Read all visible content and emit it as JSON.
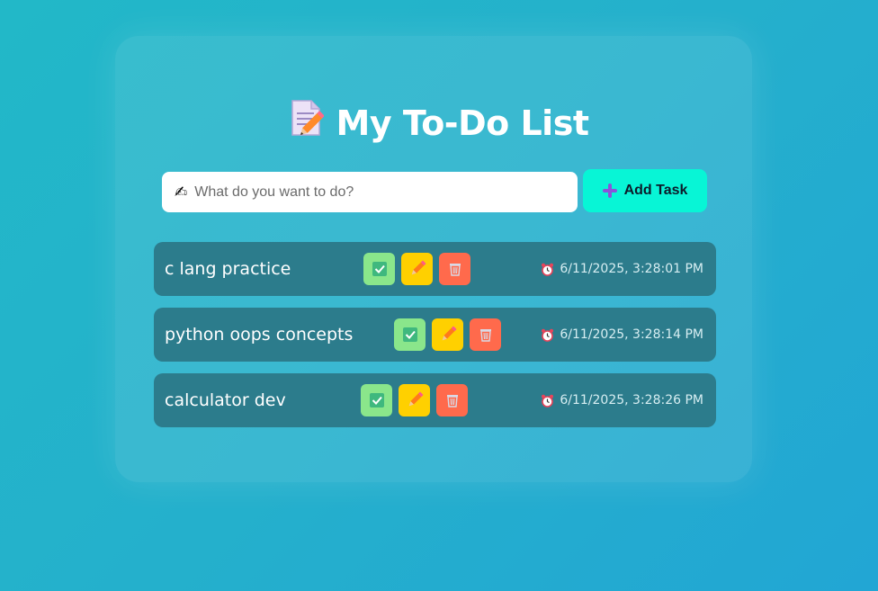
{
  "header": {
    "title": "My To-Do List",
    "title_icon": "memo-pencil-icon"
  },
  "input": {
    "placeholder": "What do you want to do?",
    "value": "",
    "icon": "writing-hand-icon"
  },
  "add_button": {
    "label": "Add Task",
    "icon": "plus-icon"
  },
  "tasks": [
    {
      "name": "c lang practice",
      "timestamp": "6/11/2025, 3:28:01 PM"
    },
    {
      "name": "python oops concepts",
      "timestamp": "6/11/2025, 3:28:14 PM"
    },
    {
      "name": "calculator dev",
      "timestamp": "6/11/2025, 3:28:26 PM"
    }
  ],
  "task_actions": [
    "check-icon",
    "pencil-icon",
    "trash-icon"
  ],
  "colors": {
    "background": "#22b0cc",
    "task_row": "#2c7c8c",
    "add_button": "#08f5d6",
    "done_button": "#8ae68b",
    "edit_button": "#ffd000",
    "delete_button": "#ff6a4c"
  }
}
